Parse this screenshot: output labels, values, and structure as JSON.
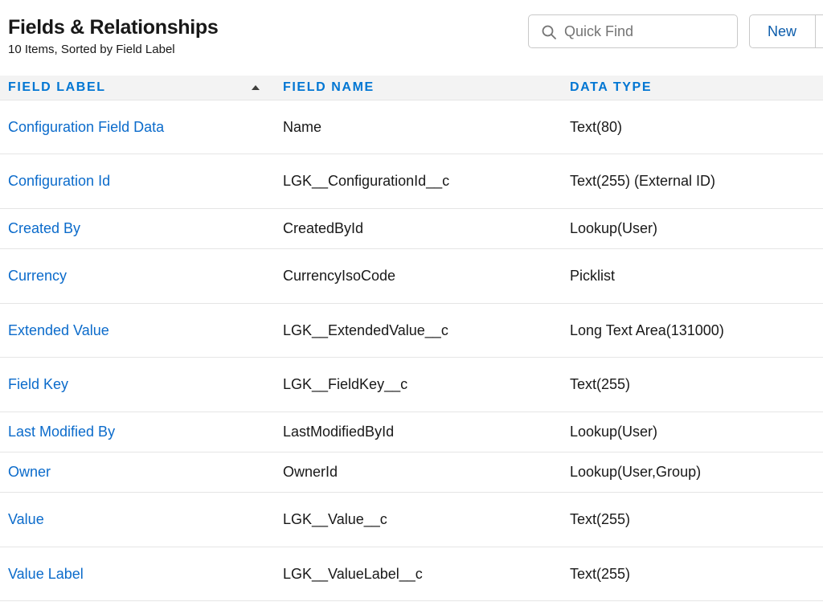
{
  "header": {
    "title": "Fields & Relationships",
    "subtitle": "10 Items, Sorted by Field Label"
  },
  "search": {
    "placeholder": "Quick Find",
    "icon": "search-icon"
  },
  "toolbar": {
    "new_label": "New"
  },
  "table": {
    "columns": [
      "FIELD LABEL",
      "FIELD NAME",
      "DATA TYPE"
    ],
    "sort_icon": "arrow-up-icon",
    "rows": [
      {
        "label": "Configuration Field Data",
        "name": "Name",
        "type": "Text(80)"
      },
      {
        "label": "Configuration Id",
        "name": "LGK__ConfigurationId__c",
        "type": "Text(255) (External ID)"
      },
      {
        "label": "Created By",
        "name": "CreatedById",
        "type": "Lookup(User)"
      },
      {
        "label": "Currency",
        "name": "CurrencyIsoCode",
        "type": "Picklist"
      },
      {
        "label": "Extended Value",
        "name": "LGK__ExtendedValue__c",
        "type": "Long Text Area(131000)"
      },
      {
        "label": "Field Key",
        "name": "LGK__FieldKey__c",
        "type": "Text(255)"
      },
      {
        "label": "Last Modified By",
        "name": "LastModifiedById",
        "type": "Lookup(User)"
      },
      {
        "label": "Owner",
        "name": "OwnerId",
        "type": "Lookup(User,Group)"
      },
      {
        "label": "Value",
        "name": "LGK__Value__c",
        "type": "Text(255)"
      },
      {
        "label": "Value Label",
        "name": "LGK__ValueLabel__c",
        "type": "Text(255)"
      }
    ]
  },
  "colors": {
    "link": "#0b6bcb",
    "header_text": "#0176d3",
    "header_bg": "#f3f3f3",
    "border": "#e5e5e5"
  }
}
